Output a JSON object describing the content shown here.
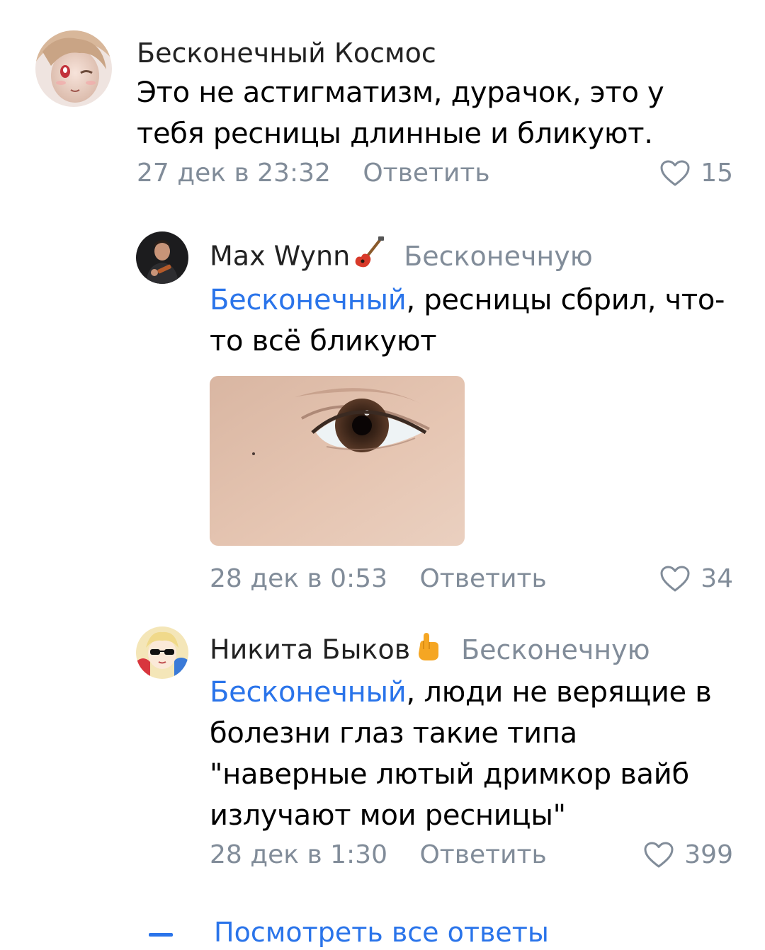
{
  "comments": [
    {
      "author": "Бесконечный Космос",
      "text": "Это не астигматизм, дурачок, это у тебя ресницы длинные и бликуют.",
      "date": "27 дек в 23:32",
      "reply_label": "Ответить",
      "likes": "15",
      "avatar_icon": "anime-girl-avatar"
    },
    {
      "author": "Max Wynn",
      "author_emoji": "guitar-icon",
      "reply_to": "Бесконечную",
      "mention": "Бесконечный",
      "text": ", ресницы сбрил, что-то всё бликуют",
      "date": "28 дек в 0:53",
      "reply_label": "Ответить",
      "likes": "34",
      "avatar_icon": "man-with-guitar-avatar",
      "photo_icon": "eye-photo"
    },
    {
      "author": "Никита Быков",
      "author_emoji": "call-me-hand-icon",
      "reply_to": "Бесконечную",
      "mention": "Бесконечный",
      "text": ", люди не верящие в болезни глаз такие типа \"наверные лютый дримкор вайб излучают мои ресницы\"",
      "date": "28 дек в 1:30",
      "reply_label": "Ответить",
      "likes": "399",
      "avatar_icon": "anime-sunglasses-avatar"
    }
  ],
  "view_all_label": "Посмотреть все ответы",
  "colors": {
    "mention": "#2a74ea",
    "meta": "#818c99",
    "text": "#000000"
  }
}
